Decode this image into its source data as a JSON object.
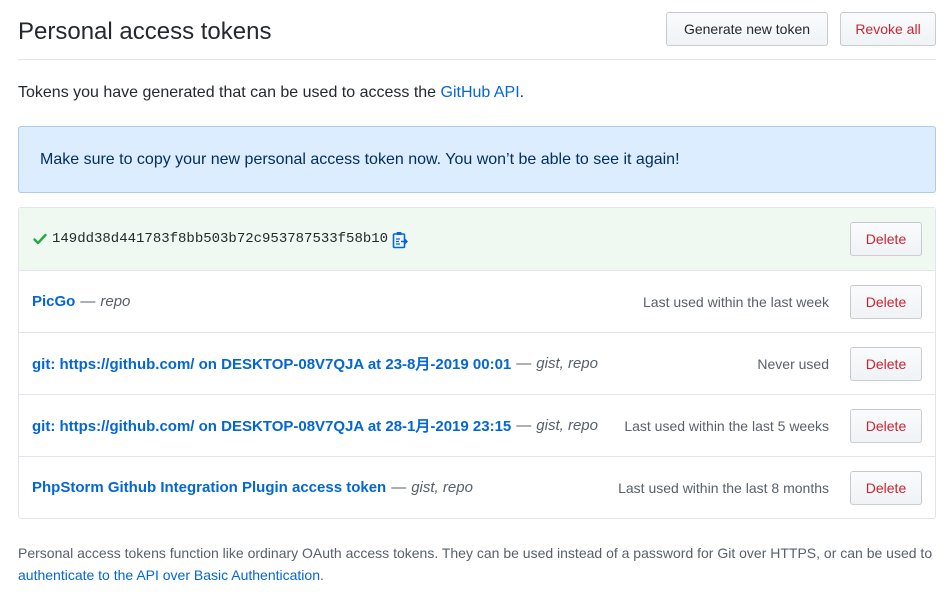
{
  "header": {
    "title": "Personal access tokens",
    "generate_label": "Generate new token",
    "revoke_label": "Revoke all"
  },
  "intro": {
    "text_before": "Tokens you have generated that can be used to access the ",
    "link": "GitHub API",
    "text_after": "."
  },
  "flash": {
    "message": "Make sure to copy your new personal access token now. You won’t be able to see it again!"
  },
  "new_token": {
    "icon": "check-icon",
    "value": "149dd38d441783f8bb503b72c953787533f58b10",
    "copy_icon": "clipboard-icon",
    "delete_label": "Delete"
  },
  "tokens": [
    {
      "name": "PicGo",
      "separator": "—",
      "scopes": "repo",
      "last_used": "Last used within the last week",
      "delete_label": "Delete"
    },
    {
      "name": "git: https://github.com/ on DESKTOP-08V7QJA at 23-8月-2019 00:01",
      "separator": "—",
      "scopes": "gist, repo",
      "last_used": "Never used",
      "delete_label": "Delete"
    },
    {
      "name": "git: https://github.com/ on DESKTOP-08V7QJA at 28-1月-2019 23:15",
      "separator": "—",
      "scopes": "gist, repo",
      "last_used": "Last used within the last 5 weeks",
      "delete_label": "Delete"
    },
    {
      "name": "PhpStorm Github Integration Plugin access token",
      "separator": "—",
      "scopes": "gist, repo",
      "last_used": "Last used within the last 8 months",
      "delete_label": "Delete"
    }
  ],
  "footer": {
    "text_before": "Personal access tokens function like ordinary OAuth access tokens. They can be used instead of a password for Git over HTTPS, or can be used to ",
    "link": "authenticate to the API over Basic Authentication",
    "text_after": "."
  },
  "colors": {
    "link": "#0366d6",
    "danger": "#cb2431",
    "flash_bg": "#dbedff",
    "success_bg": "#eff8f1",
    "success": "#28a745"
  }
}
